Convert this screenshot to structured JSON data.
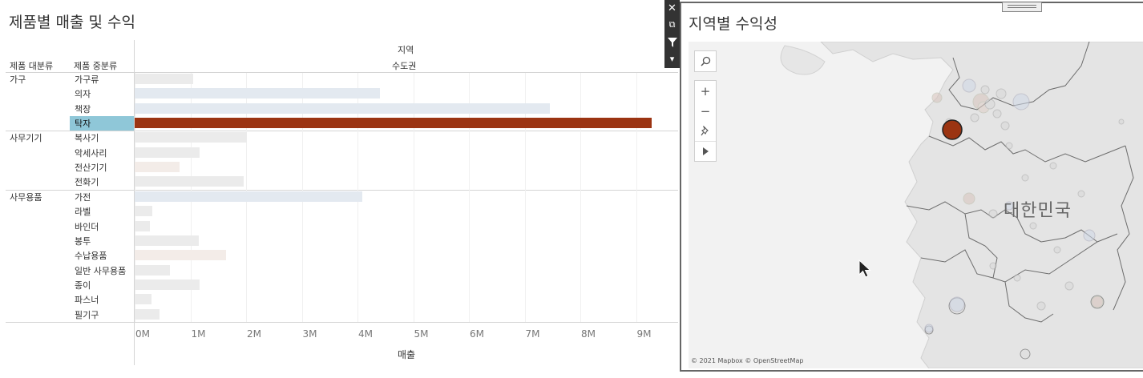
{
  "left": {
    "title": "제품별 매출 및 수익",
    "col_header_group": "지역",
    "col_header_region": "수도권",
    "row_header_category": "제품 대분류",
    "row_header_subcategory": "제품 중분류",
    "x_axis_label": "매출"
  },
  "chart_data": {
    "type": "bar",
    "orientation": "horizontal",
    "title": "제품별 매출 및 수익",
    "xlabel": "매출",
    "column_region": "수도권",
    "xlim": [
      0,
      9.5
    ],
    "x_ticks": [
      "0M",
      "1M",
      "2M",
      "3M",
      "4M",
      "5M",
      "6M",
      "7M",
      "8M",
      "9M"
    ],
    "groups": [
      {
        "category": "가구",
        "items": [
          {
            "name": "가구류",
            "value": 1.05,
            "color": "#ebebeb"
          },
          {
            "name": "의자",
            "value": 4.4,
            "color": "#e3e9f0"
          },
          {
            "name": "책장",
            "value": 7.45,
            "color": "#e3e9f0"
          },
          {
            "name": "탁자",
            "value": 9.28,
            "color": "#9b3412",
            "selected": true
          }
        ]
      },
      {
        "category": "사무기기",
        "items": [
          {
            "name": "복사기",
            "value": 2.02,
            "color": "#ebebeb"
          },
          {
            "name": "악세사리",
            "value": 1.17,
            "color": "#ebebeb"
          },
          {
            "name": "전산기기",
            "value": 0.81,
            "color": "#f3ece8"
          },
          {
            "name": "전화기",
            "value": 1.95,
            "color": "#ebebeb"
          }
        ]
      },
      {
        "category": "사무용품",
        "items": [
          {
            "name": "가전",
            "value": 4.08,
            "color": "#e3e9f0"
          },
          {
            "name": "라벨",
            "value": 0.31,
            "color": "#ebebeb"
          },
          {
            "name": "바인더",
            "value": 0.28,
            "color": "#ebebeb"
          },
          {
            "name": "봉투",
            "value": 1.15,
            "color": "#ebebeb"
          },
          {
            "name": "수납용품",
            "value": 1.64,
            "color": "#f3ece8"
          },
          {
            "name": "일반 사무용품",
            "value": 0.63,
            "color": "#ebebeb"
          },
          {
            "name": "종이",
            "value": 1.17,
            "color": "#ebebeb"
          },
          {
            "name": "파스너",
            "value": 0.3,
            "color": "#ebebeb"
          },
          {
            "name": "필기구",
            "value": 0.44,
            "color": "#ebebeb"
          }
        ]
      }
    ]
  },
  "toolbar": {
    "items": [
      {
        "name": "close-icon",
        "glyph": "✕"
      },
      {
        "name": "popout-icon",
        "glyph": "⧉"
      },
      {
        "name": "filter-icon",
        "glyph": "▼"
      },
      {
        "name": "more-options-icon",
        "glyph": "▾"
      }
    ]
  },
  "map": {
    "title": "지역별 수익성",
    "country_label": "대한민국",
    "attribution": "© 2021 Mapbox © OpenStreetMap",
    "highlight_color": "#9b3412",
    "tools": {
      "search": "search-icon",
      "zoom_in": "+",
      "zoom_out": "−",
      "pin": "pin-icon",
      "expand": "play-icon"
    }
  }
}
